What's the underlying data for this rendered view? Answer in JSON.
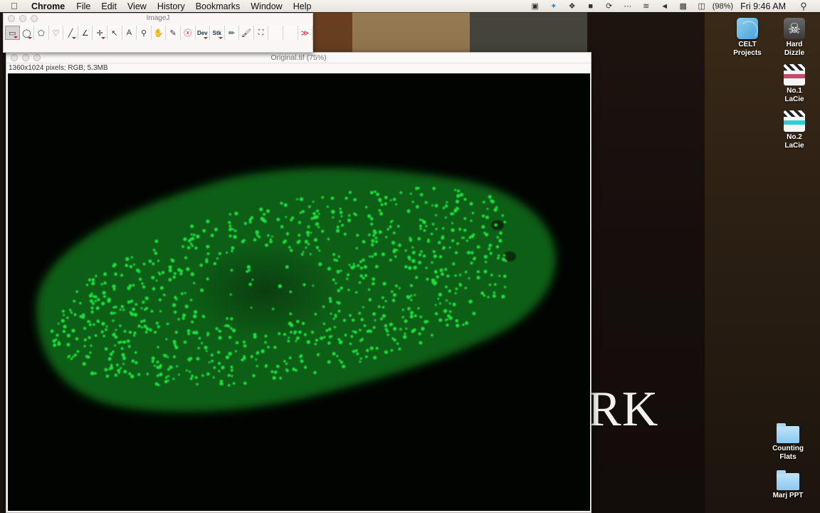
{
  "menubar": {
    "app_name": "Chrome",
    "menus": [
      "File",
      "Edit",
      "View",
      "History",
      "Bookmarks",
      "Window",
      "Help"
    ],
    "status_icons": [
      "screen-record-icon",
      "twitter-icon",
      "dropbox-icon",
      "display-icon",
      "sync-icon",
      "ellipsis-icon",
      "wifi-icon",
      "volume-icon",
      "input-menu-icon",
      "battery-icon"
    ],
    "battery_percent": "(98%)",
    "clock": "Fri 9:46 AM"
  },
  "imagej_toolbar": {
    "title": "ImageJ",
    "tools": [
      {
        "name": "rectangle-tool",
        "glyph": "▭",
        "menu": true,
        "active": true
      },
      {
        "name": "oval-tool",
        "glyph": "◯",
        "menu": true
      },
      {
        "name": "polygon-tool",
        "glyph": "⬠",
        "menu": false
      },
      {
        "name": "freehand-tool",
        "glyph": "♡",
        "menu": false
      },
      {
        "name": "line-tool",
        "glyph": "╱",
        "menu": true
      },
      {
        "name": "angle-tool",
        "glyph": "∠",
        "menu": false
      },
      {
        "name": "point-tool",
        "glyph": "✛",
        "menu": true
      },
      {
        "name": "wand-tool",
        "glyph": "↖",
        "menu": false
      },
      {
        "name": "text-tool",
        "glyph": "A",
        "menu": false
      },
      {
        "name": "zoom-tool",
        "glyph": "⚲",
        "menu": false
      },
      {
        "name": "hand-tool",
        "glyph": "✋",
        "menu": false
      },
      {
        "name": "color-picker-tool",
        "glyph": "✎",
        "menu": false
      },
      {
        "name": "remove-overlay-tool",
        "glyph": "ⓧ",
        "menu": false
      },
      {
        "name": "developer-menu-tool",
        "glyph": "Dev",
        "menu": true
      },
      {
        "name": "stack-tools",
        "glyph": "Stk",
        "menu": true
      },
      {
        "name": "pencil-tool",
        "glyph": "✏",
        "menu": false
      },
      {
        "name": "brush-tool",
        "glyph": "🖌",
        "menu": false
      },
      {
        "name": "flood-fill-tool",
        "glyph": "⛶",
        "menu": false
      },
      {
        "name": "empty-slot-1",
        "glyph": "",
        "menu": false
      },
      {
        "name": "empty-slot-2",
        "glyph": "",
        "menu": false
      },
      {
        "name": "more-tools",
        "glyph": "≫",
        "menu": false
      }
    ]
  },
  "image_window": {
    "title": "Original.tif (75%)",
    "info": "1360x1024 pixels; RGB; 5.3MB",
    "content": "fluorescence micrograph of a green-stained flatworm with bright puncta"
  },
  "desktop": {
    "wallpaper_text": "RK",
    "icons": [
      {
        "label_1": "CELT",
        "label_2": "Projects",
        "type": "celt"
      },
      {
        "label_1": "Hard",
        "label_2": "Dizzle",
        "type": "drive"
      },
      {
        "label_1": "No.1",
        "label_2": "LaCie",
        "type": "clap-red"
      },
      {
        "label_1": "No.2",
        "label_2": "LaCie",
        "type": "clap-teal"
      },
      {
        "label_1": "Counting",
        "label_2": "Flats",
        "type": "folder"
      },
      {
        "label_1": "Marj PPT",
        "label_2": "",
        "type": "folder"
      }
    ]
  },
  "colors": {
    "fluorescence": "#1fe040",
    "worm_body": "#0a5a12",
    "menubar": "#efebe6"
  }
}
